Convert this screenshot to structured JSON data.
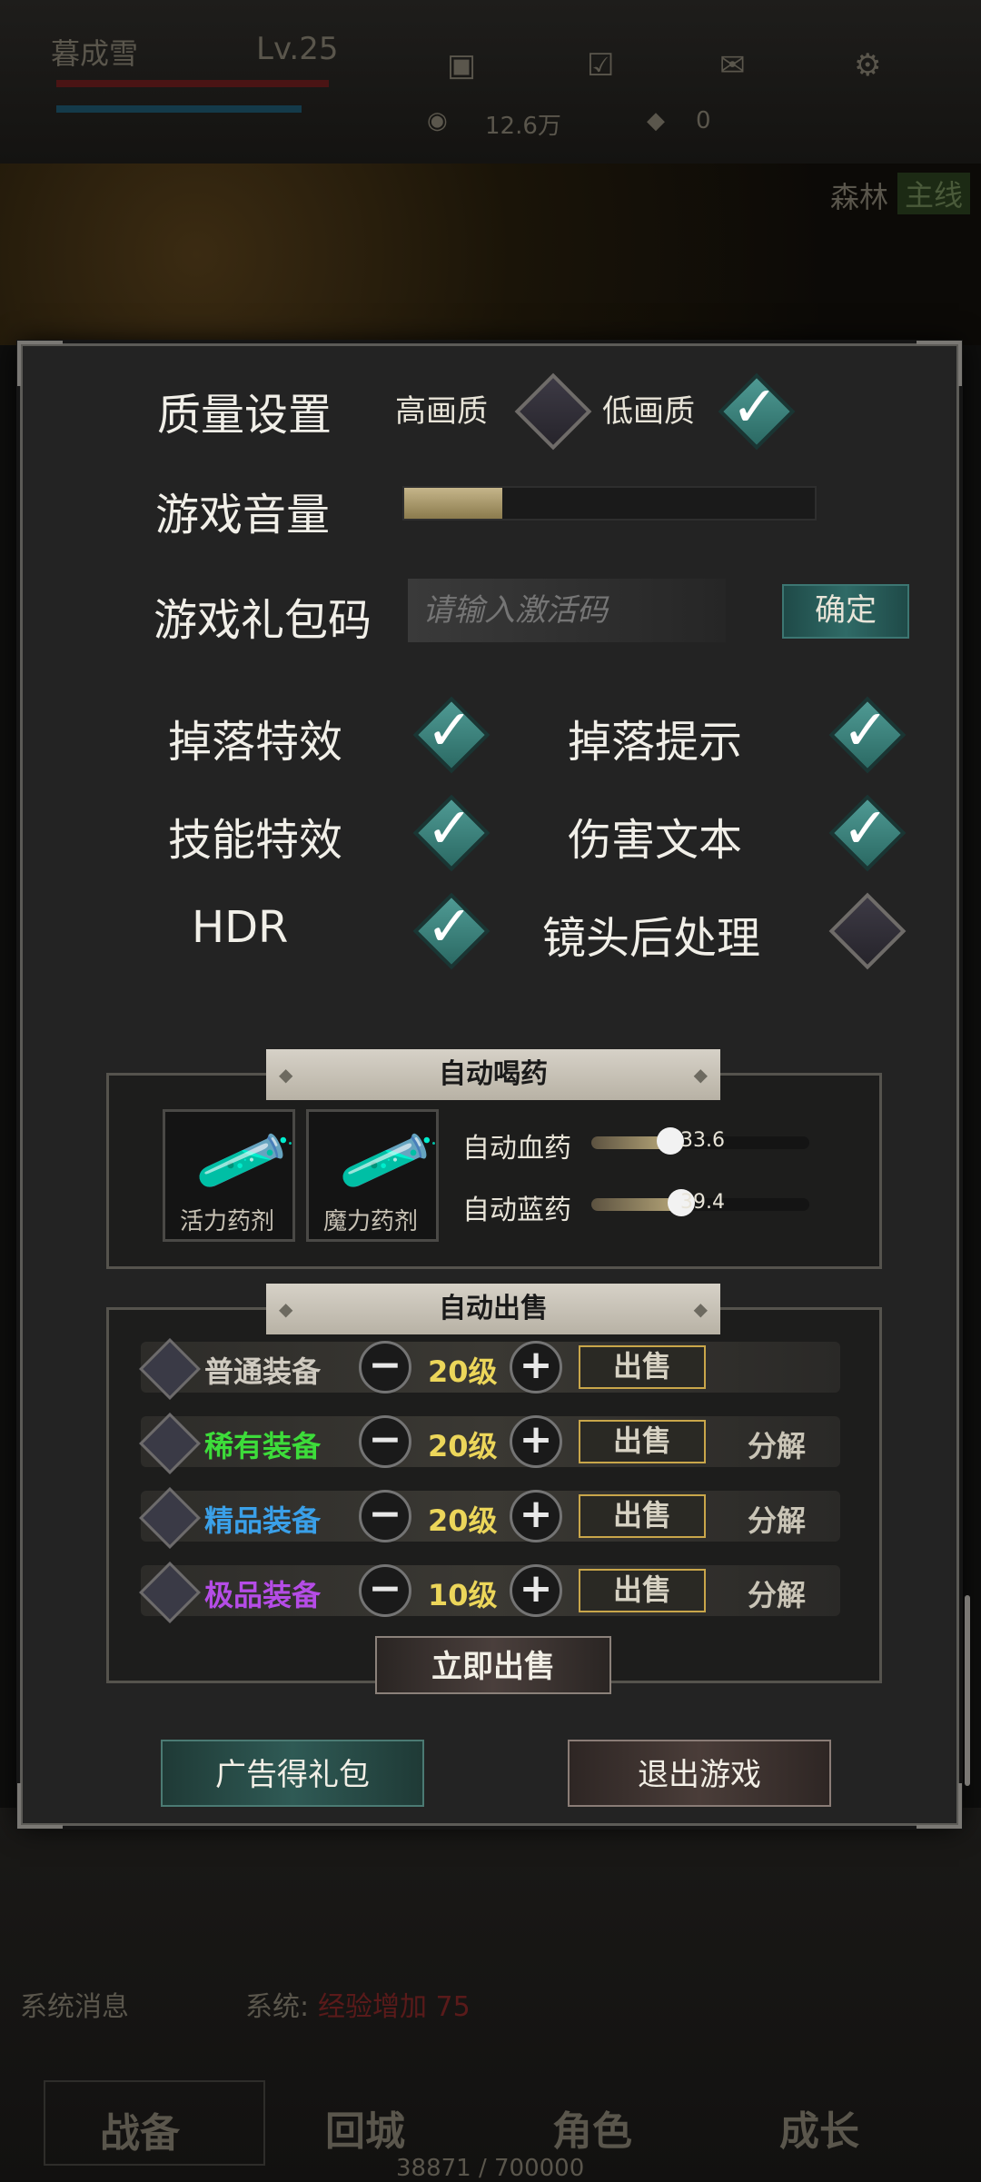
{
  "hud": {
    "player_name": "暮成雪",
    "level": "Lv.25",
    "gold": "12.6万",
    "gems": "0",
    "zone": "森林",
    "zone_tag": "主线"
  },
  "settings": {
    "quality_label": "质量设置",
    "high_quality": "高画质",
    "low_quality": "低画质",
    "high_checked": false,
    "low_checked": true,
    "volume_label": "游戏音量",
    "volume_level": 0.24,
    "gift_code_label": "游戏礼包码",
    "gift_code_placeholder": "请输入激活码",
    "confirm_label": "确定",
    "toggles": [
      {
        "label": "掉落特效",
        "checked": true
      },
      {
        "label": "掉落提示",
        "checked": true
      },
      {
        "label": "技能特效",
        "checked": true
      },
      {
        "label": "伤害文本",
        "checked": true
      },
      {
        "label": "HDR",
        "checked": true
      },
      {
        "label": "镜头后处理",
        "checked": false
      }
    ]
  },
  "auto_potion": {
    "title": "自动喝药",
    "hp_potion": "活力药剂",
    "mp_potion": "魔力药剂",
    "hp_label": "自动血药",
    "hp_value": "33.6",
    "mp_label": "自动蓝药",
    "mp_value": "39.4"
  },
  "auto_sell": {
    "title": "自动出售",
    "rows": [
      {
        "name": "普通装备",
        "color": "#cfcac0",
        "level": "20级",
        "sell": "出售",
        "decompose": ""
      },
      {
        "name": "稀有装备",
        "color": "#3ddc3a",
        "level": "20级",
        "sell": "出售",
        "decompose": "分解"
      },
      {
        "name": "精品装备",
        "color": "#3aa0e8",
        "level": "20级",
        "sell": "出售",
        "decompose": "分解"
      },
      {
        "name": "极品装备",
        "color": "#b54ce6",
        "level": "10级",
        "sell": "出售",
        "decompose": "分解"
      }
    ],
    "sell_now": "立即出售"
  },
  "footer": {
    "ad_gift": "广告得礼包",
    "exit_game": "退出游戏"
  },
  "behind": {
    "sys_msg_label": "系统消息",
    "sys_prefix": "系统:",
    "sys_text": "经验增加 75",
    "tabs": [
      "战备",
      "回城",
      "角色",
      "成长"
    ],
    "exp": "38871 / 700000"
  }
}
